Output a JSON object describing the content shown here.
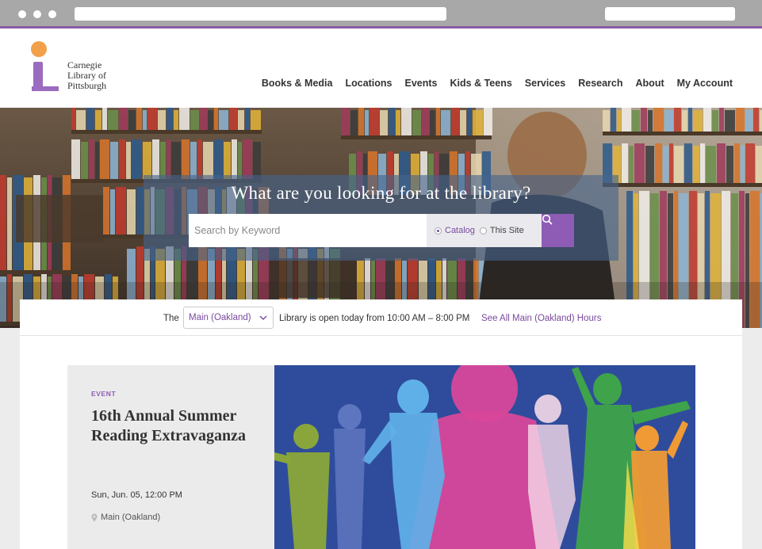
{
  "site": {
    "name": "Carnegie\nLibrary of\nPittsburgh"
  },
  "nav": {
    "items": [
      "Books & Media",
      "Locations",
      "Events",
      "Kids & Teens",
      "Services",
      "Research",
      "About",
      "My Account"
    ]
  },
  "search": {
    "title": "What are you looking for at the library?",
    "placeholder": "Search by Keyword",
    "scope_options": [
      "Catalog",
      "This Site"
    ],
    "scope_selected": "Catalog"
  },
  "hours": {
    "prefix": "The",
    "location_selected": "Main (Oakland)",
    "status_text": "Library is open today from 10:00 AM – 8:00 PM",
    "link": "See All Main (Oakland) Hours"
  },
  "event": {
    "tag": "EVENT",
    "title": "16th Annual Summer Reading Extravaganza",
    "date": "Sun, Jun. 05, 12:00 PM",
    "location": "Main (Oakland)"
  },
  "colors": {
    "brand_purple": "#8e5bb5",
    "brand_orange": "#f2a04a",
    "link_purple": "#7a4a9e",
    "event_bg": "#2f4c9c"
  }
}
